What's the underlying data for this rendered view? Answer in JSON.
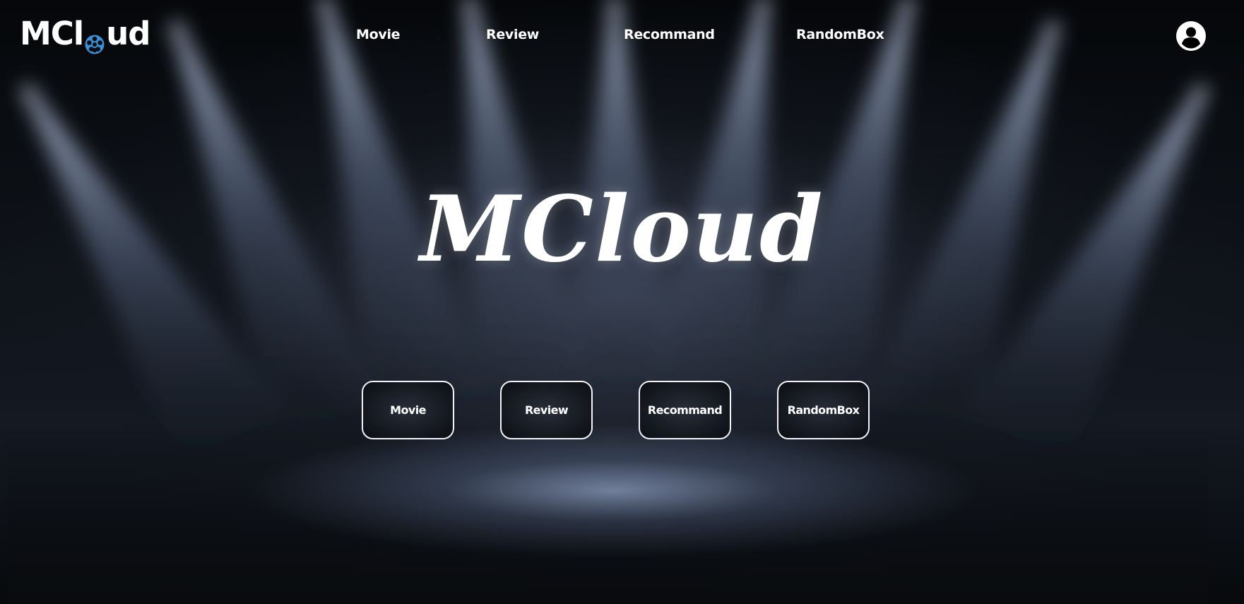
{
  "brand": {
    "logo_prefix": "MCl",
    "logo_suffix": "ud",
    "logo_icon": "film-reel-icon",
    "accent_color": "#3b8fd6"
  },
  "nav": {
    "items": [
      {
        "label": "Movie"
      },
      {
        "label": "Review"
      },
      {
        "label": "Recommand"
      },
      {
        "label": "RandomBox"
      }
    ],
    "profile_icon": "user-circle-icon"
  },
  "hero": {
    "title": "MCloud",
    "buttons": [
      {
        "label": "Movie"
      },
      {
        "label": "Review"
      },
      {
        "label": "Recommand"
      },
      {
        "label": "RandomBox"
      }
    ]
  },
  "theme": {
    "background": "#000000",
    "spotlight_color": "#a8badb",
    "text_color": "#ffffff"
  }
}
